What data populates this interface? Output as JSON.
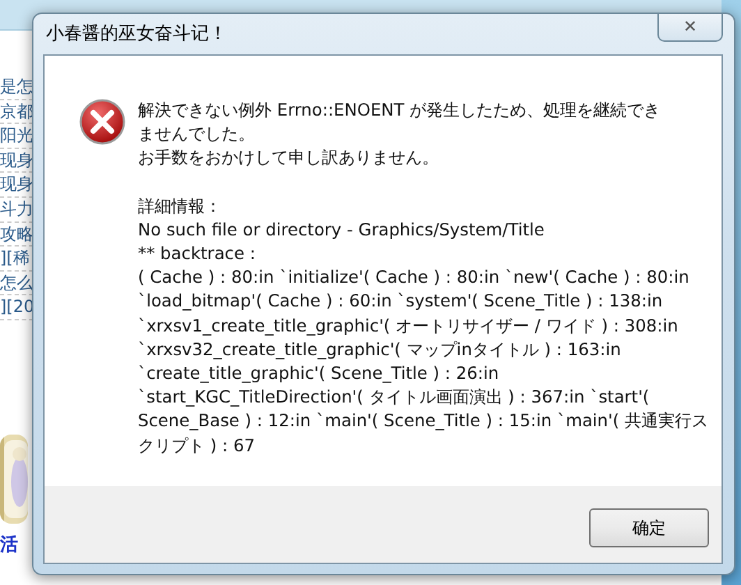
{
  "background_page": {
    "links": [
      "是怎",
      "京都",
      "阳光",
      "现身",
      "现身",
      "斗力",
      "攻略",
      "][稀",
      "怎么",
      "][20"
    ],
    "bottom_link": "活"
  },
  "dialog": {
    "title": "小春醤的巫女奋斗记！",
    "close_label": "✕",
    "message_lines": [
      "解決できない例外 Errno::ENOENT が発生したため、処理を継続でき",
      "ませんでした。",
      "お手数をおかけして申し訳ありません。"
    ],
    "detail_lines": [
      "詳細情報：",
      "No such file or directory - Graphics/System/Title",
      "** backtrace :",
      "( Cache ) : 80:in `initialize'( Cache ) : 80:in `new'( Cache ) : 80:in",
      "`load_bitmap'( Cache ) : 60:in `system'( Scene_Title ) : 138:in",
      "`xrxsv1_create_title_graphic'( オートリサイザー / ワイド ) : 308:in",
      "`xrxsv32_create_title_graphic'( マップinタイトル ) : 163:in",
      "`create_title_graphic'( Scene_Title ) : 26:in",
      "`start_KGC_TitleDirection'( タイトル画面演出 ) : 367:in `start'(",
      "Scene_Base ) : 12:in `main'( Scene_Title ) : 15:in `main'( 共通実行ス",
      "クリプト ) : 67"
    ],
    "buttons": [
      "确定"
    ]
  }
}
